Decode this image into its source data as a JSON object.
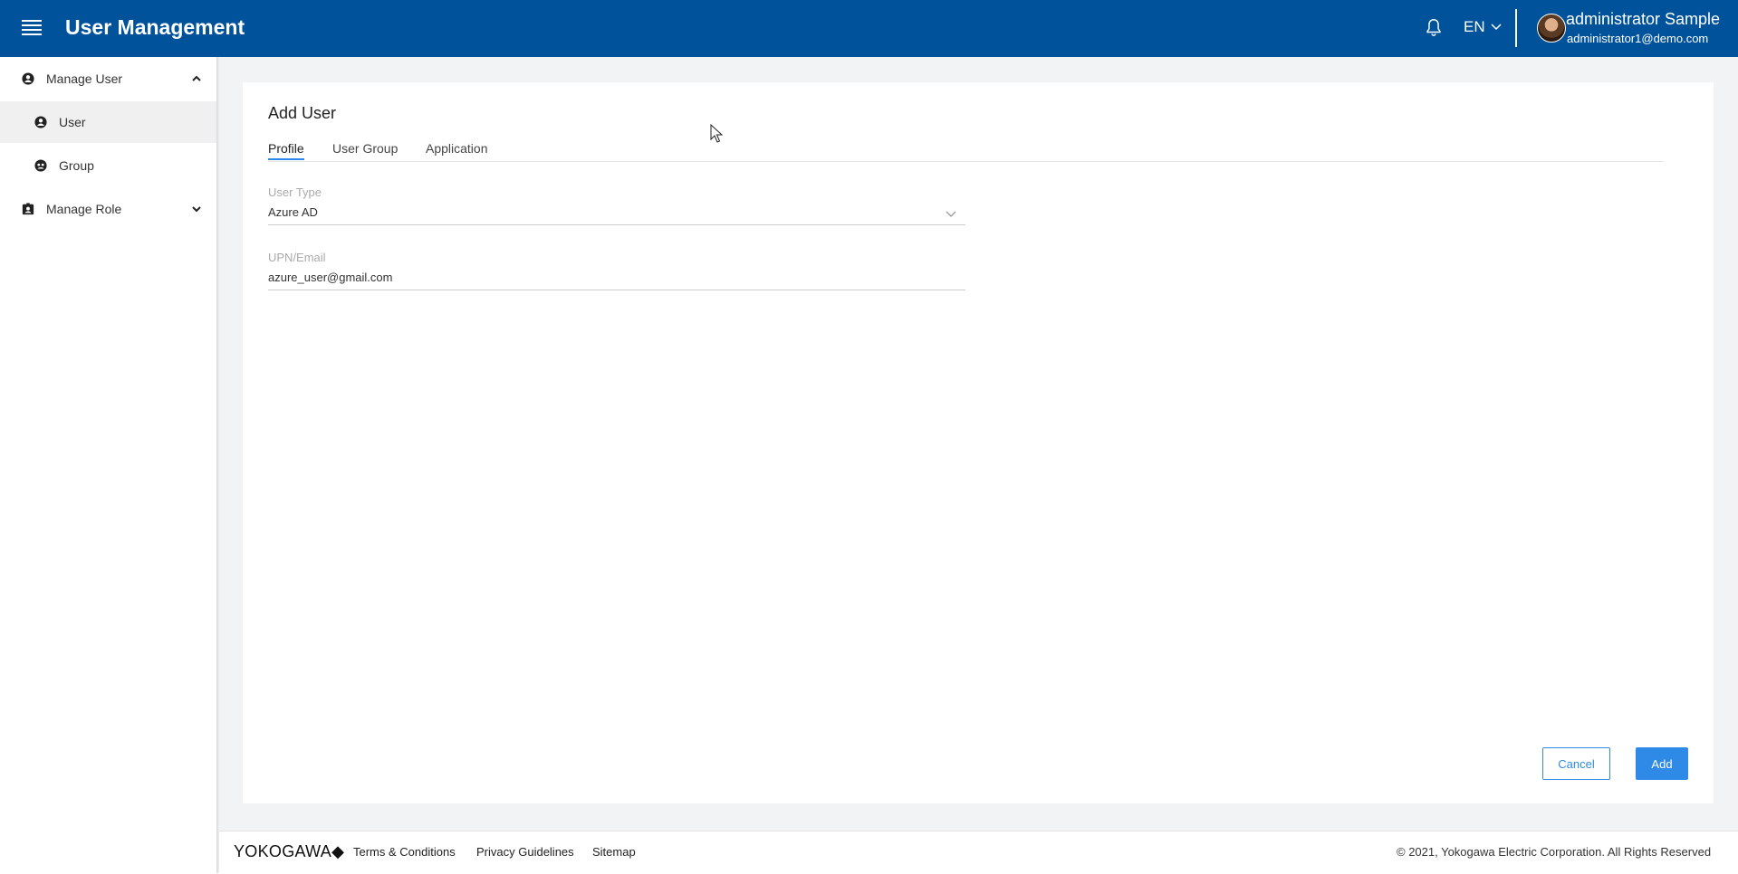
{
  "header": {
    "title": "User Management",
    "language": "EN",
    "user_name": "administrator Sample",
    "user_email": "administrator1@demo.com",
    "color": "#00529b"
  },
  "sidebar": {
    "items": [
      {
        "label": "Manage User",
        "icon": "account-circle-icon",
        "expanded": true
      },
      {
        "label": "User",
        "icon": "account-circle-icon",
        "active": true
      },
      {
        "label": "Group",
        "icon": "group-icon"
      },
      {
        "label": "Manage Role",
        "icon": "badge-icon",
        "expanded": false
      }
    ]
  },
  "form": {
    "title": "Add User",
    "tabs": [
      {
        "label": "Profile",
        "active": true
      },
      {
        "label": "User Group"
      },
      {
        "label": "Application"
      }
    ],
    "user_type": {
      "label": "User Type",
      "value": "Azure AD"
    },
    "upn_email": {
      "label": "UPN/Email",
      "value": "azure_user@gmail.com"
    },
    "cancel_label": "Cancel",
    "add_label": "Add",
    "accent_color": "#2e8ae6"
  },
  "footer": {
    "logo": "YOKOGAWA◆",
    "links": [
      "Terms & Conditions",
      "Privacy Guidelines",
      "Sitemap"
    ],
    "copyright": "© 2021, Yokogawa Electric Corporation. All Rights Reserved"
  }
}
